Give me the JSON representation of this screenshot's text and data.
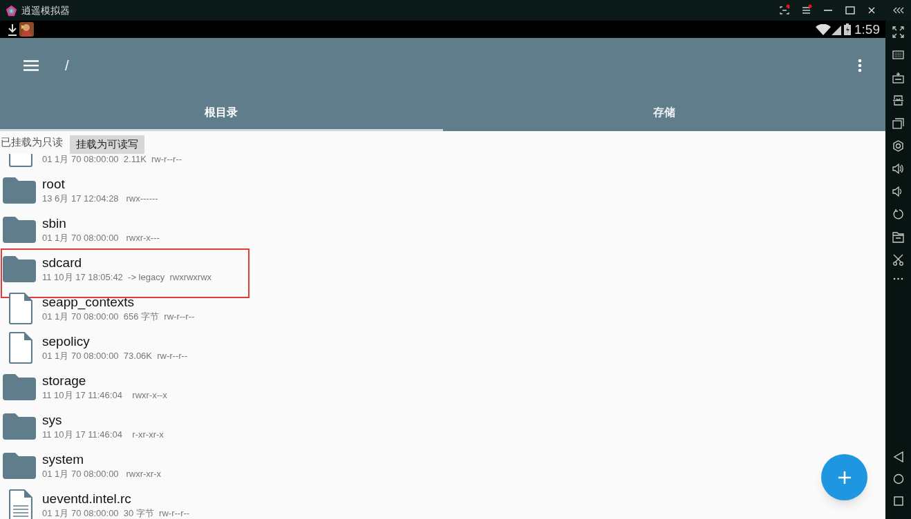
{
  "window": {
    "title": "逍遥模拟器"
  },
  "status_bar": {
    "time": "1:59"
  },
  "toolbar": {
    "path": "/"
  },
  "tabs": [
    {
      "label": "根目录",
      "selected": true
    },
    {
      "label": "存储",
      "selected": false
    }
  ],
  "mount_bar": {
    "status": "已挂载为只读",
    "button": "挂载为可读写"
  },
  "files": [
    {
      "kind": "file",
      "meta": "01 1月 70 08:00:00  2.11K  rw-r--r--",
      "highlighted": false
    },
    {
      "kind": "folder",
      "name": "root",
      "meta": "13 6月 17 12:04:28   rwx------",
      "highlighted": false
    },
    {
      "kind": "folder",
      "name": "sbin",
      "meta": "01 1月 70 08:00:00   rwxr-x---",
      "highlighted": false
    },
    {
      "kind": "folder",
      "name": "sdcard",
      "meta": "11 10月 17 18:05:42  -> legacy  rwxrwxrwx",
      "highlighted": true
    },
    {
      "kind": "file",
      "name": "seapp_contexts",
      "meta": "01 1月 70 08:00:00  656 字节  rw-r--r--",
      "highlighted": false
    },
    {
      "kind": "file",
      "name": "sepolicy",
      "meta": "01 1月 70 08:00:00  73.06K  rw-r--r--",
      "highlighted": false
    },
    {
      "kind": "folder",
      "name": "storage",
      "meta": "11 10月 17 11:46:04    rwxr-x--x",
      "highlighted": false
    },
    {
      "kind": "folder",
      "name": "sys",
      "meta": "11 10月 17 11:46:04    r-xr-xr-x",
      "highlighted": false
    },
    {
      "kind": "folder",
      "name": "system",
      "meta": "01 1月 70 08:00:00   rwxr-xr-x",
      "highlighted": false
    },
    {
      "kind": "text-file",
      "name": "ueventd.intel.rc",
      "meta": "01 1月 70 08:00:00  30 字节  rw-r--r--",
      "highlighted": false
    }
  ]
}
